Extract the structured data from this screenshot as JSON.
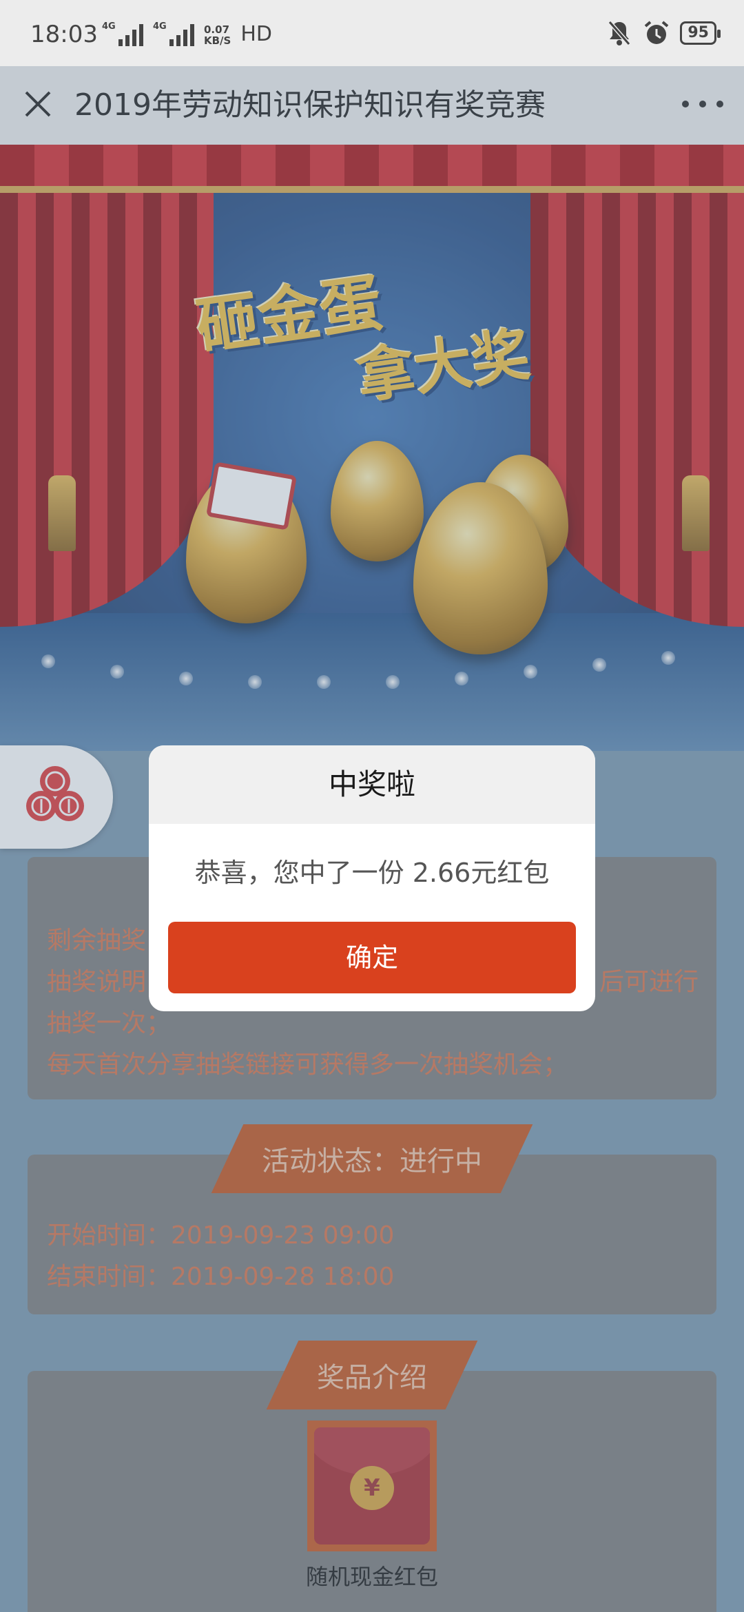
{
  "status_bar": {
    "time": "18:03",
    "network_1": "4G",
    "network_2": "4G",
    "speed_value": "0.07",
    "speed_unit": "KB/S",
    "hd": "HD",
    "battery": "95"
  },
  "navbar": {
    "title": "2019年劳动知识保护知识有奖竞赛"
  },
  "banner": {
    "headline_line1": "砸金蛋",
    "headline_line2": "拿大奖"
  },
  "info_card": {
    "remaining_label": "剩余抽奖",
    "desc_line1_start": "抽奖说明",
    "desc_line1_end": "后可进行",
    "desc_line2": "抽奖一次；",
    "desc_line3": "每天首次分享抽奖链接可获得多一次抽奖机会；"
  },
  "status_card": {
    "ribbon": "活动状态：进行中",
    "start_label": "开始时间：",
    "start_time": "2019-09-23 09:00",
    "end_label": "结束时间：",
    "end_time": "2019-09-28 18:00"
  },
  "prize_card": {
    "ribbon": "奖品介绍",
    "coin_symbol": "¥",
    "prize_name": "随机现金红包"
  },
  "modal": {
    "title": "中奖啦",
    "message": "恭喜，您中了一份 2.66元红包",
    "confirm": "确定"
  },
  "colors": {
    "accent": "#d9411e",
    "ribbon": "#c4501a",
    "text_orange": "#d86f45"
  }
}
